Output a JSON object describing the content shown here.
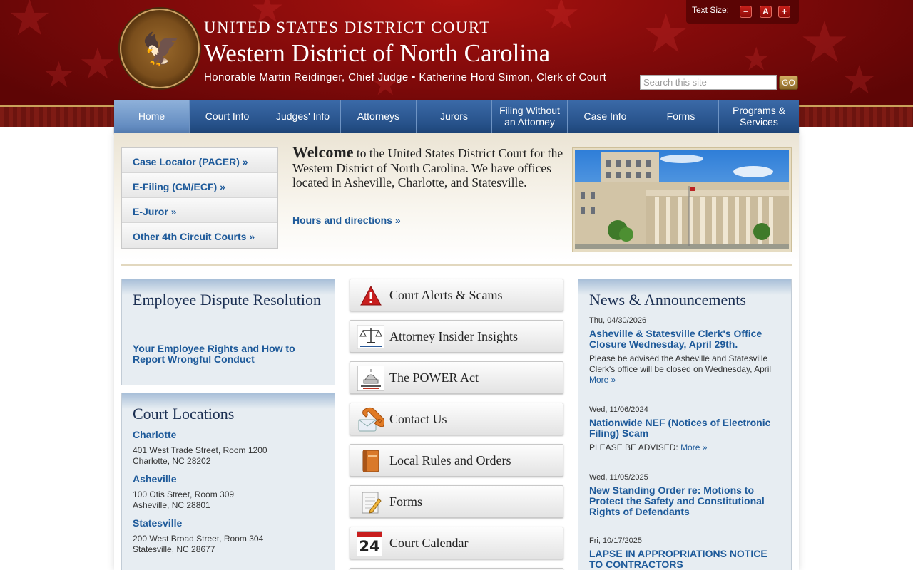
{
  "header": {
    "court_line": "UNITED STATES DISTRICT COURT",
    "district": "Western District of North Carolina",
    "officials": "Honorable Martin Reidinger, Chief Judge • Katherine Hord Simon, Clerk of Court",
    "text_size": {
      "label": "Text Size:",
      "decrease": "−",
      "reset": "A",
      "increase": "+"
    },
    "search": {
      "placeholder": "Search this site",
      "button": "GO"
    }
  },
  "nav": [
    {
      "label": "Home"
    },
    {
      "label": "Court Info"
    },
    {
      "label": "Judges' Info"
    },
    {
      "label": "Attorneys"
    },
    {
      "label": "Jurors"
    },
    {
      "label": "Filing Without an Attorney"
    },
    {
      "label": "Case Info"
    },
    {
      "label": "Forms"
    },
    {
      "label": "Programs & Services"
    }
  ],
  "quick_links": [
    "Case Locator (PACER) »",
    "E-Filing (CM/ECF) »",
    "E-Juror »",
    "Other 4th Circuit Courts »"
  ],
  "welcome": {
    "heading": "Welcome",
    "text": " to the United States District Court for the Western District of North Carolina. We have offices located in Asheville, Charlotte, and Statesville.",
    "hours_link": "Hours and directions »"
  },
  "employee_dispute": {
    "title": "Employee Dispute Resolution",
    "link": "Your Employee Rights and How to Report Wrongful Conduct"
  },
  "locations": {
    "title": "Court Locations",
    "items": [
      {
        "name": "Charlotte",
        "line1": "401 West Trade Street, Room 1200",
        "line2": "Charlotte, NC  28202"
      },
      {
        "name": "Asheville",
        "line1": "100 Otis Street, Room 309",
        "line2": "Asheville, NC  28801"
      },
      {
        "name": "Statesville",
        "line1": "200 West Broad Street, Room 304",
        "line2": "Statesville, NC  28677"
      }
    ]
  },
  "tiles": [
    {
      "label": "Court Alerts & Scams",
      "icon": "alert-icon"
    },
    {
      "label": "Attorney Insider Insights",
      "icon": "scales-icon"
    },
    {
      "label": "The POWER Act",
      "icon": "congress-icon"
    },
    {
      "label": "Contact Us",
      "icon": "phone-icon"
    },
    {
      "label": "Local Rules and Orders",
      "icon": "book-icon"
    },
    {
      "label": "Forms",
      "icon": "form-icon"
    },
    {
      "label": "Court Calendar",
      "icon": "calendar-icon",
      "calendar_day": "24"
    }
  ],
  "news": {
    "title": "News & Announcements",
    "items": [
      {
        "date": "Thu, 04/30/2026",
        "headline": "Asheville & Statesville Clerk's Office Closure Wednesday, April 29th.",
        "text": "Please be advised the Asheville and Statesville Clerk's office will be closed on Wednesday, April",
        "more": "More »"
      },
      {
        "date": "Wed, 11/06/2024",
        "headline": "Nationwide NEF (Notices of Electronic Filing) Scam",
        "text": "PLEASE BE ADVISED: ",
        "more": "More »"
      },
      {
        "date": "Wed, 11/05/2025",
        "headline": "New Standing Order re: Motions to Protect the Safety and Constitutional Rights of Defendants"
      },
      {
        "date": "Fri, 10/17/2025",
        "headline": "LAPSE IN APPROPRIATIONS NOTICE TO CONTRACTORS"
      }
    ]
  },
  "colors": {
    "brand_red": "#860b0b",
    "nav_blue": "#20497f",
    "link_blue": "#1e5a9a",
    "panel_bg": "#e7edf2"
  }
}
